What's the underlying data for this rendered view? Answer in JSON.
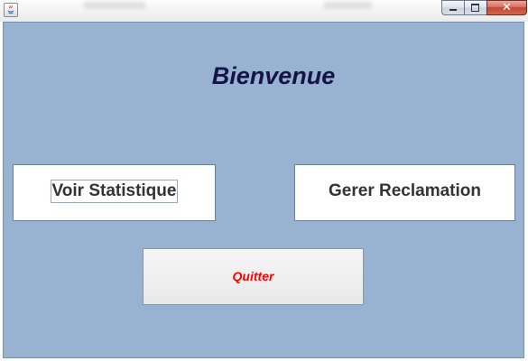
{
  "window": {
    "controls": {
      "close_glyph": "✕"
    }
  },
  "main": {
    "heading": "Bienvenue",
    "buttons": {
      "statistique": "Voir Statistique",
      "reclamation": "Gerer Reclamation",
      "quitter": "Quitter"
    }
  },
  "colors": {
    "panel_background": "#98b2d1",
    "heading_text": "#141446",
    "quit_text": "#ff0000",
    "close_button": "#c24732"
  }
}
